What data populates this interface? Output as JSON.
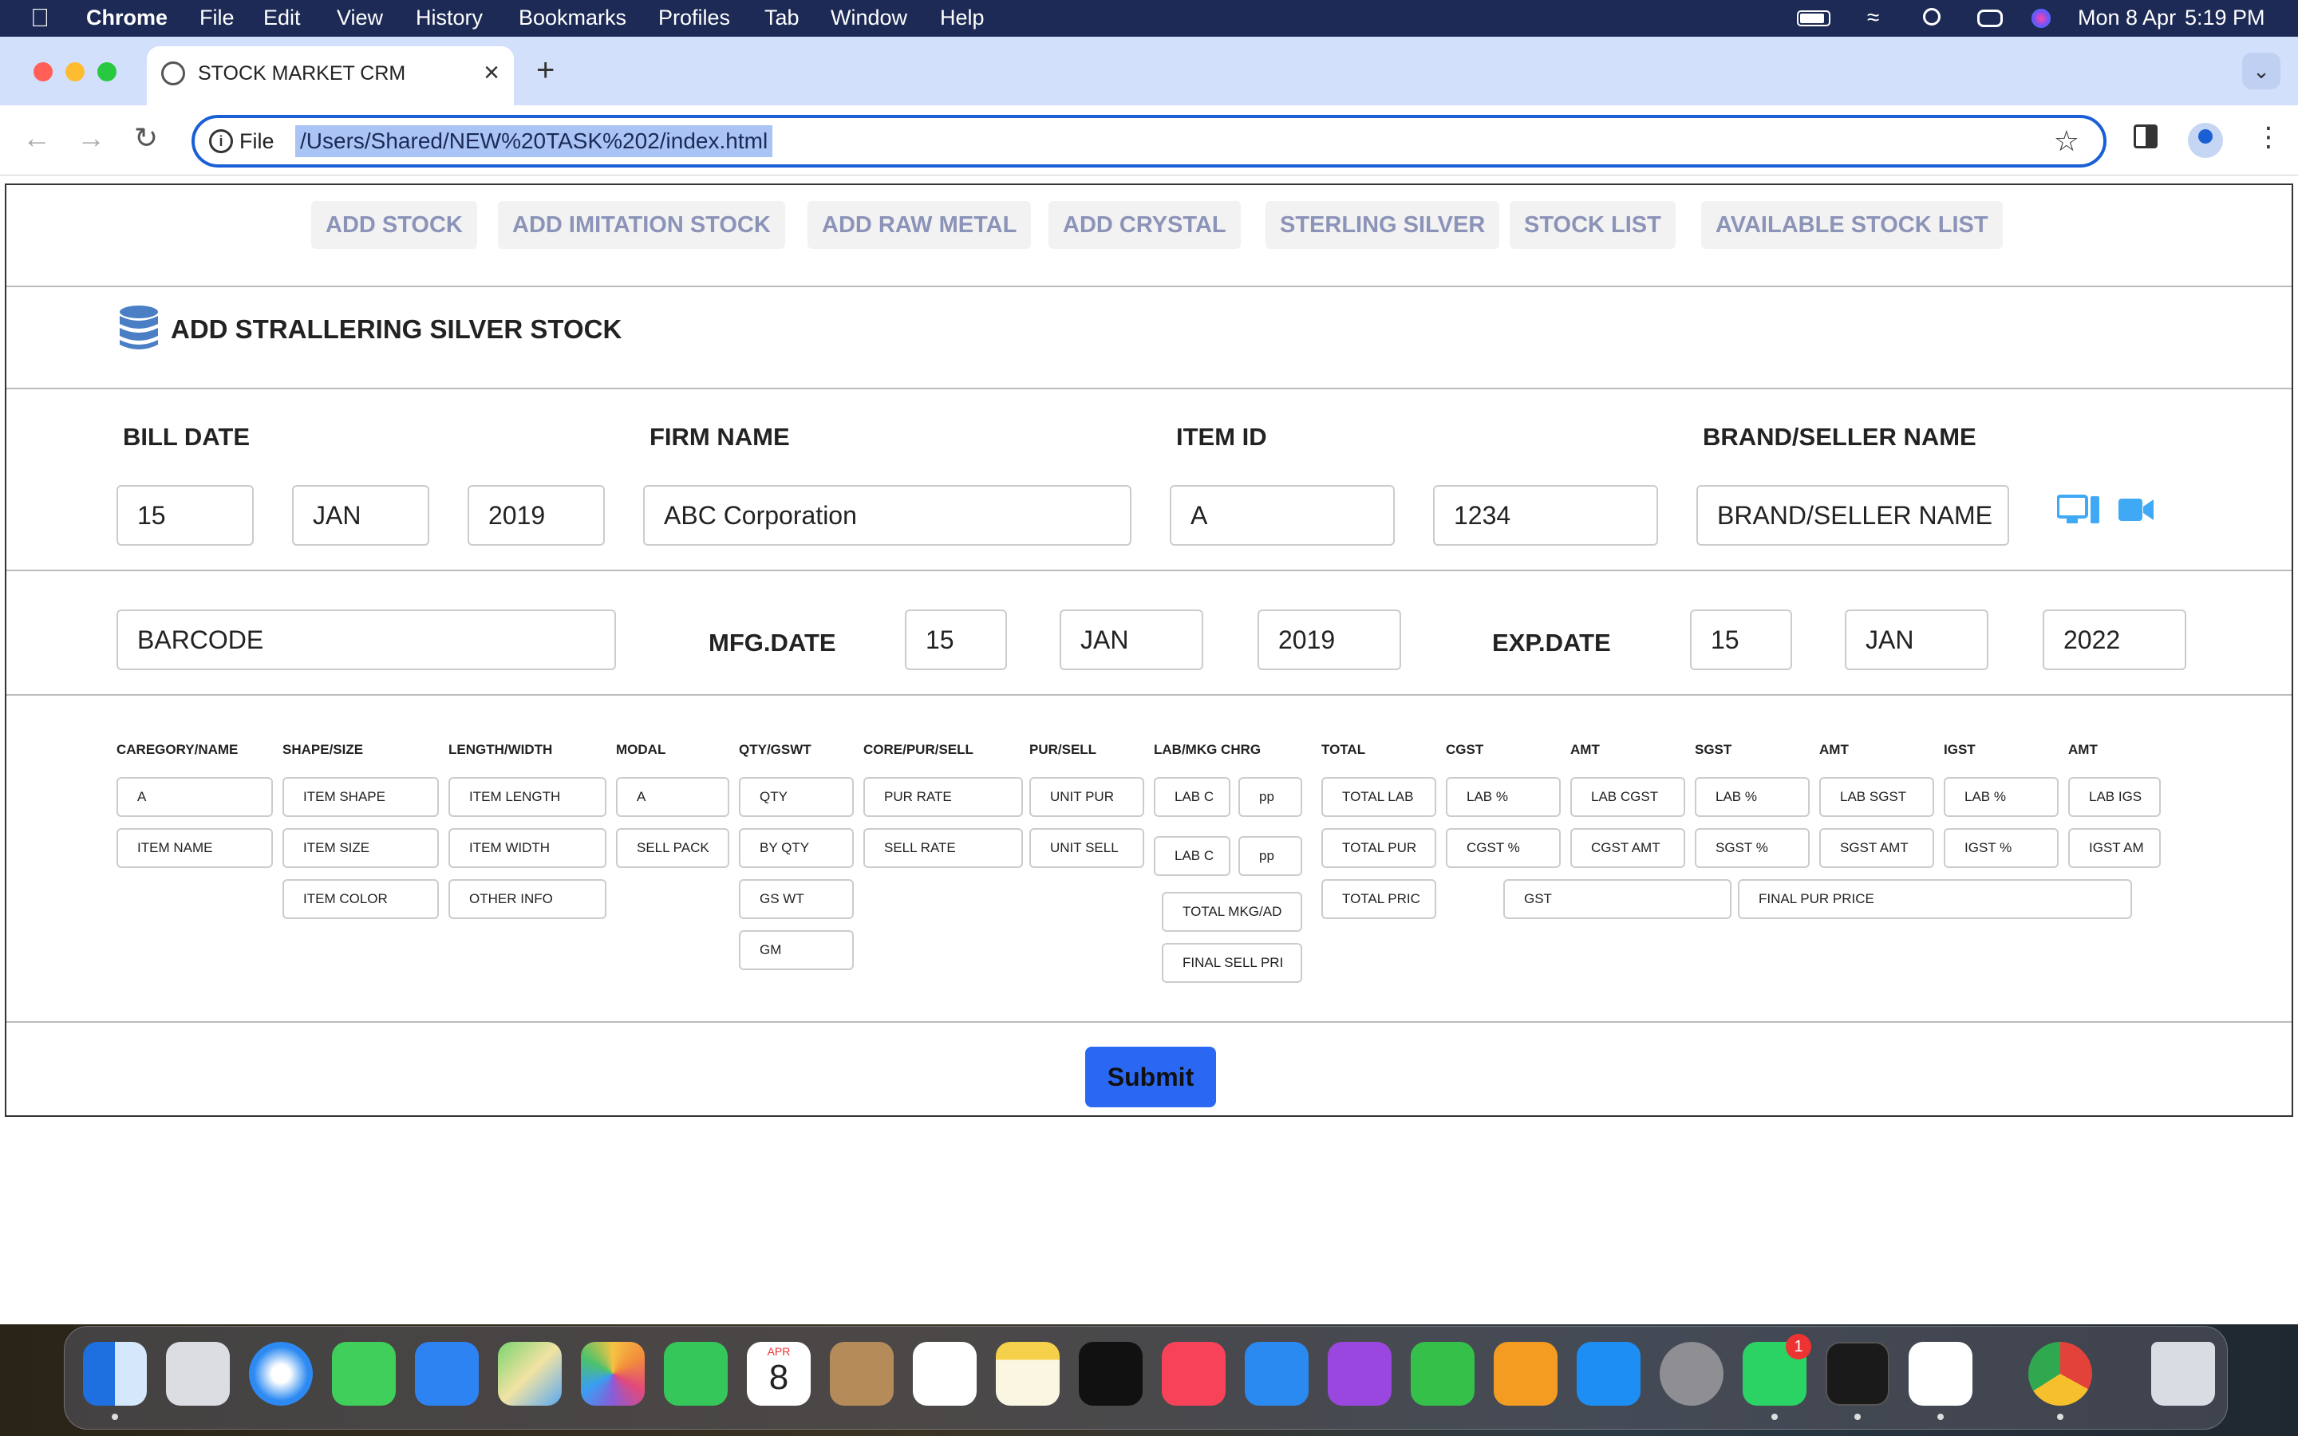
{
  "menubar": {
    "app_name": "Chrome",
    "menus": [
      "File",
      "Edit",
      "View",
      "History",
      "Bookmarks",
      "Profiles",
      "Tab",
      "Window",
      "Help"
    ],
    "date": "Mon 8 Apr",
    "time": "5:19 PM"
  },
  "browser": {
    "tab_title": "STOCK MARKET CRM",
    "scheme_label": "File",
    "url": "/Users/Shared/NEW%20TASK%202/index.html"
  },
  "nav": [
    "ADD STOCK",
    "ADD IMITATION STOCK",
    "ADD RAW METAL",
    "ADD CRYSTAL",
    "STERLING SILVER",
    "STOCK LIST",
    "AVAILABLE STOCK LIST"
  ],
  "page_title": "ADD STRALLERING SILVER STOCK",
  "row1": {
    "labels": {
      "bill_date": "BILL DATE",
      "firm_name": "FIRM NAME",
      "item_id": "ITEM ID",
      "brand": "BRAND/SELLER NAME"
    },
    "values": {
      "day": "15",
      "month": "JAN",
      "year": "2019",
      "firm": "ABC Corporation",
      "item_prefix": "A",
      "item_number": "1234",
      "brand": "BRAND/SELLER NAME"
    }
  },
  "row2": {
    "barcode": "BARCODE",
    "mfg_label": "MFG.DATE",
    "mfg_day": "15",
    "mfg_month": "JAN",
    "mfg_year": "2019",
    "exp_label": "EXP.DATE",
    "exp_day": "15",
    "exp_month": "JAN",
    "exp_year": "2022"
  },
  "grid": {
    "headers": [
      "CAREGORY/NAME",
      "SHAPE/SIZE",
      "LENGTH/WIDTH",
      "MODAL",
      "QTY/GSWT",
      "CORE/PUR/SELL",
      "PUR/SELL",
      "LAB/MKG CHRG",
      "TOTAL",
      "CGST",
      "AMT",
      "SGST",
      "AMT",
      "IGST",
      "AMT"
    ],
    "fields": {
      "cat_a": "A",
      "item_name": "ITEM NAME",
      "item_shape": "ITEM SHAPE",
      "item_size": "ITEM SIZE",
      "item_color": "ITEM COLOR",
      "item_length": "ITEM LENGTH",
      "item_width": "ITEM WIDTH",
      "other_info": "OTHER INFO",
      "modal_a": "A",
      "sell_pack": "SELL PACK",
      "qty": "QTY",
      "by_qty": "BY QTY",
      "gs_wt": "GS WT",
      "gm": "GM",
      "pur_rate": "PUR RATE",
      "sell_rate": "SELL RATE",
      "unit_pur": "UNIT PUR",
      "unit_sell": "UNIT SELL",
      "lab_1": "LAB C",
      "pp_1": "pp",
      "lab_2": "LAB C",
      "pp_2": "pp",
      "total_mkg": "TOTAL MKG/AD",
      "final_sell": "FINAL SELL PRI",
      "total_lab": "TOTAL LAB",
      "total_pur": "TOTAL PUR",
      "total_pri": "TOTAL PRIC",
      "cgst_lab": "LAB %",
      "cgst_pct": "CGST %",
      "cgst_lab_amt": "LAB CGST",
      "cgst_amt": "CGST AMT",
      "sgst_lab": "LAB %",
      "sgst_pct": "SGST %",
      "sgst_lab_amt": "LAB SGST",
      "sgst_amt": "SGST AMT",
      "igst_lab": "LAB %",
      "igst_pct": "IGST %",
      "igst_lab_amt": "LAB IGS",
      "igst_amt": "IGST AM",
      "gst": "GST",
      "final_pur": "FINAL PUR PRICE"
    }
  },
  "submit_label": "Submit",
  "dock": {
    "calendar_month": "APR",
    "calendar_day": "8",
    "whatsapp_badge": "1"
  }
}
